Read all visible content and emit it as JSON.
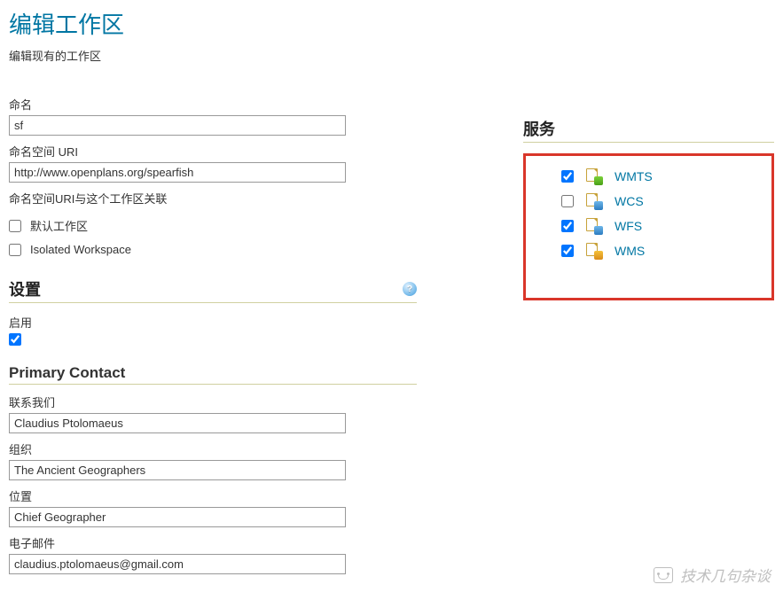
{
  "page": {
    "title": "编辑工作区",
    "subtitle": "编辑现有的工作区"
  },
  "basic": {
    "name_label": "命名",
    "name_value": "sf",
    "uri_label": "命名空间 URI",
    "uri_value": "http://www.openplans.org/spearfish",
    "uri_hint": "命名空间URI与这个工作区关联",
    "default_ws_label": "默认工作区",
    "default_ws_checked": false,
    "isolated_label": "Isolated Workspace",
    "isolated_checked": false
  },
  "settings": {
    "header": "设置",
    "enabled_label": "启用",
    "enabled_checked": true
  },
  "contact": {
    "header": "Primary Contact",
    "contact_label": "联系我们",
    "contact_value": "Claudius Ptolomaeus",
    "org_label": "组织",
    "org_value": "The Ancient Geographers",
    "position_label": "位置",
    "position_value": "Chief Geographer",
    "email_label": "电子邮件",
    "email_value": "claudius.ptolomaeus@gmail.com"
  },
  "services": {
    "header": "服务",
    "items": [
      {
        "label": "WMTS",
        "checked": true,
        "badge": "badge-wmts"
      },
      {
        "label": "WCS",
        "checked": false,
        "badge": "badge-wcs"
      },
      {
        "label": "WFS",
        "checked": true,
        "badge": "badge-wfs"
      },
      {
        "label": "WMS",
        "checked": true,
        "badge": "badge-wms"
      }
    ]
  },
  "watermark": "技术几句杂谈"
}
